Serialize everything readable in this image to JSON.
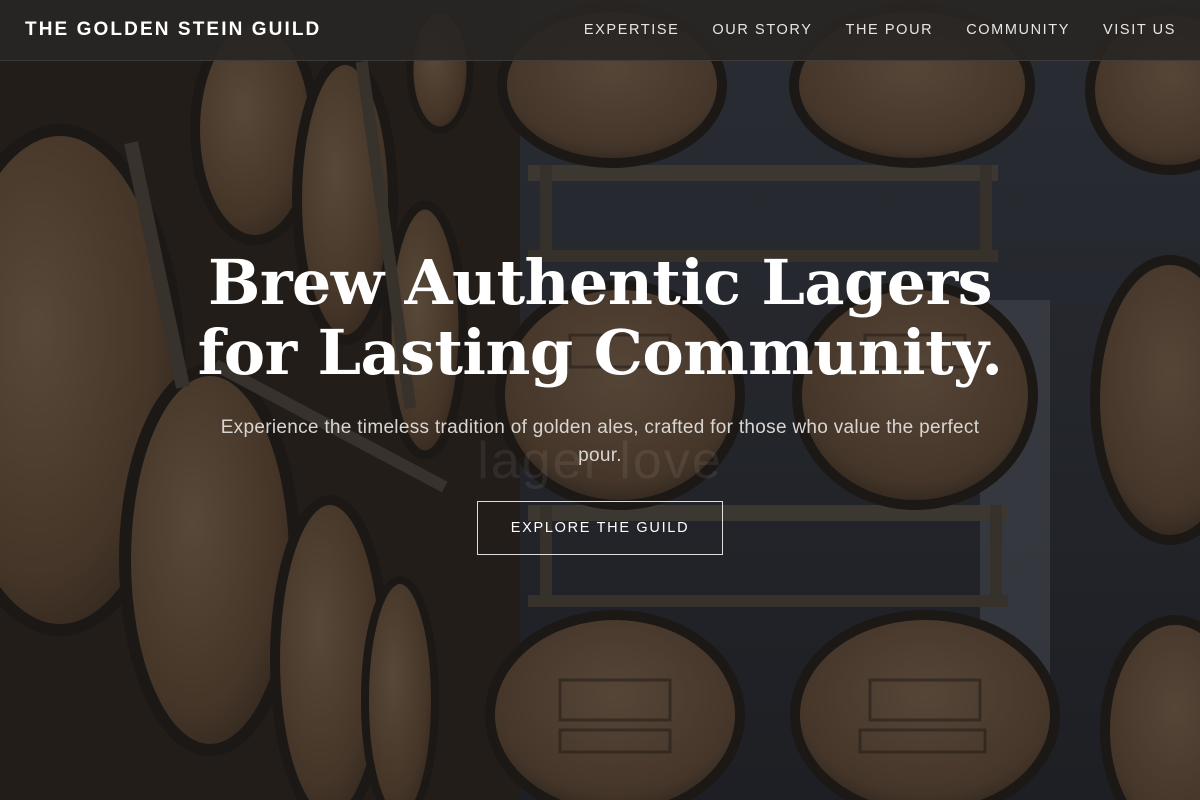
{
  "header": {
    "brand": "THE GOLDEN STEIN GUILD",
    "nav": [
      {
        "label": "EXPERTISE"
      },
      {
        "label": "OUR STORY"
      },
      {
        "label": "THE POUR"
      },
      {
        "label": "COMMUNITY"
      },
      {
        "label": "VISIT US"
      }
    ]
  },
  "hero": {
    "headline_line1": "Brew Authentic Lagers",
    "headline_line2": "for Lasting Community.",
    "watermark": "lager love",
    "subtitle": "Experience the timeless tradition of golden ales, crafted for those who value the perfect pour.",
    "cta_label": "EXPLORE THE GUILD"
  },
  "colors": {
    "nav_background": "#2a2826",
    "text_primary": "#ffffff",
    "barrel_wood": "#a07c58",
    "barrel_hoop": "#2c2520",
    "warehouse_wall": "#3f4a58"
  }
}
